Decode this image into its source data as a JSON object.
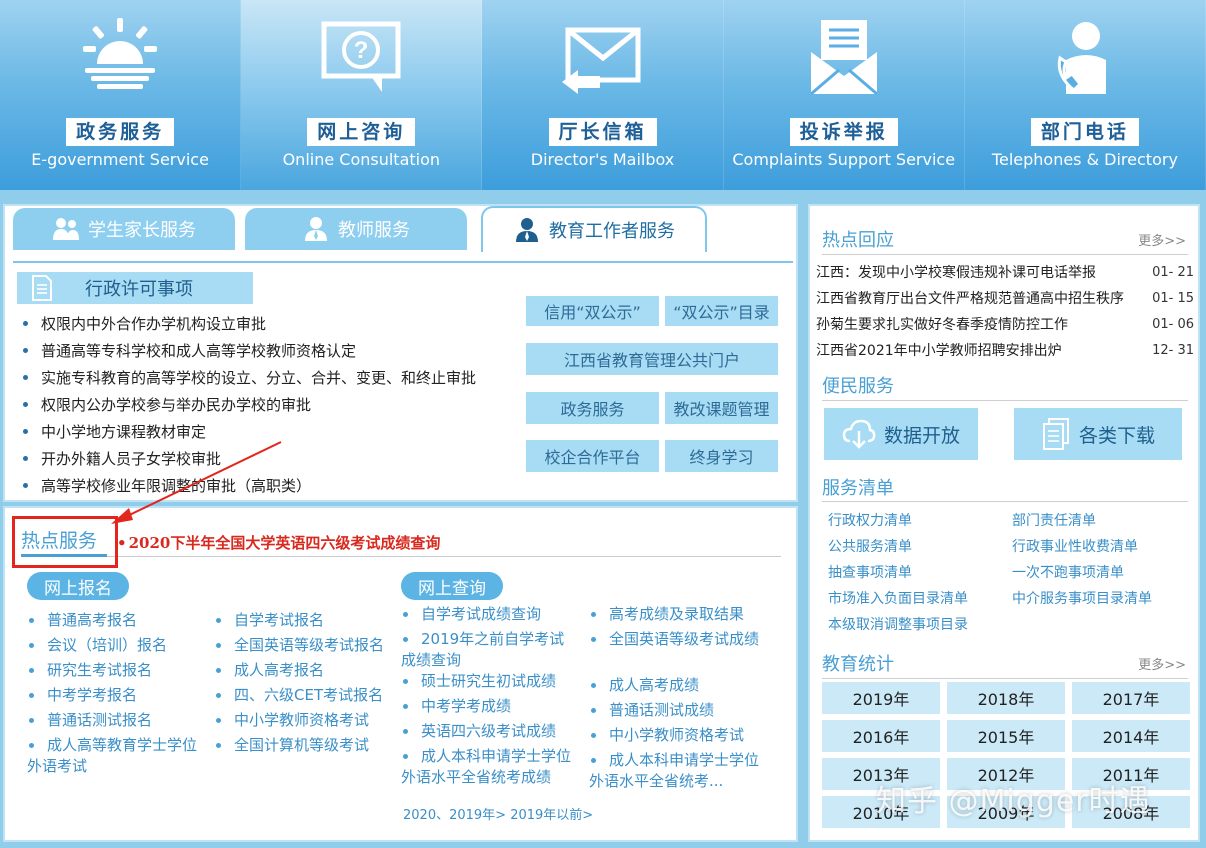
{
  "topnav": [
    {
      "cn": "政务服务",
      "en": "E-government Service",
      "icon": "sunrise-icon"
    },
    {
      "cn": "网上咨询",
      "en": "Online Consultation",
      "icon": "question-bubble-icon"
    },
    {
      "cn": "厅长信箱",
      "en": "Director's Mailbox",
      "icon": "mail-reply-icon"
    },
    {
      "cn": "投诉举报",
      "en": "Complaints Support Service",
      "icon": "complaint-mail-icon"
    },
    {
      "cn": "部门电话",
      "en": "Telephones & Directory",
      "icon": "phone-person-icon"
    }
  ],
  "tabs": [
    {
      "label": "学生家长服务",
      "icon": "parents-icon"
    },
    {
      "label": "教师服务",
      "icon": "teacher-icon"
    },
    {
      "label": "教育工作者服务",
      "icon": "educator-icon"
    }
  ],
  "admin": {
    "title": "行政许可事项",
    "items": [
      "权限内中外合作办学机构设立审批",
      "普通高等专科学校和成人高等学校教师资格认定",
      "实施专科教育的高等学校的设立、分立、合并、变更、和终止审批",
      "权限内公办学校参与举办民办学校的审批",
      "中小学地方课程教材审定",
      "开办外籍人员子女学校审批",
      "高等学校修业年限调整的审批（高职类）"
    ]
  },
  "quick": {
    "b1": "信用“双公示”",
    "b2": "“双公示”目录",
    "b3": "江西省教育管理公共门户",
    "b4": "政务服务",
    "b5": "教改课题管理",
    "b6": "校企合作平台",
    "b7": "终身学习"
  },
  "hot": {
    "title": "热点服务",
    "link": "2020下半年全国大学英语四六级考试成绩查询",
    "signup": {
      "title": "网上报名",
      "col1": [
        "普通高考报名",
        "会议（培训）报名",
        "研究生考试报名",
        "中考学考报名",
        "普通话测试报名"
      ],
      "col1_last_a": "成人高等教育学士学位",
      "col1_last_b": "外语考试",
      "col2": [
        "自学考试报名",
        "全国英语等级考试报名",
        "成人高考报名",
        "四、六级CET考试报名",
        "中小学教师资格考试",
        "全国计算机等级考试"
      ]
    },
    "query": {
      "title": "网上查询",
      "col1_a": "自学考试成绩查询",
      "col1_b1": "2019年之前自学考试",
      "col1_b2": "成绩查询",
      "col1_rest": [
        "硕士研究生初试成绩",
        "中考学考成绩",
        "英语四六级考试成绩"
      ],
      "col1_last_a": "成人本科申请学士学位",
      "col1_last_b": "外语水平全省统考成绩",
      "col2": [
        "高考成绩及录取结果",
        "全国英语等级考试成绩",
        "成人高考成绩",
        "普通话测试成绩",
        "中小学教师资格考试"
      ],
      "col2_last_a": "成人本科申请学士学位",
      "col2_last_b": "外语水平全省统考...",
      "years": "2020、2019年> 2019年以前>"
    }
  },
  "right": {
    "news_title": "热点回应",
    "more": "更多>>",
    "news": [
      {
        "title": "江西：发现中小学校寒假违规补课可电话举报",
        "date": "01- 21"
      },
      {
        "title": "江西省教育厅出台文件严格规范普通高中招生秩序",
        "date": "01- 15"
      },
      {
        "title": "孙菊生要求扎实做好冬春季疫情防控工作",
        "date": "01- 06"
      },
      {
        "title": "江西省2021年中小学教师招聘安排出炉",
        "date": "12- 31"
      }
    ],
    "convenience_title": "便民服务",
    "btn_data": "数据开放",
    "btn_download": "各类下载",
    "svc_title": "服务清单",
    "svc_left": [
      "行政权力清单",
      "公共服务清单",
      "抽查事项清单",
      "市场准入负面目录清单",
      "本级取消调整事项目录"
    ],
    "svc_right": [
      "部门责任清单",
      "行政事业性收费清单",
      "一次不跑事项清单",
      "中介服务事项目录清单"
    ],
    "stats_title": "教育统计",
    "stats_more": "更多>>",
    "years": [
      "2019年",
      "2018年",
      "2017年",
      "2016年",
      "2015年",
      "2014年",
      "2013年",
      "2012年",
      "2011年",
      "2010年",
      "2009年",
      "2008年"
    ]
  },
  "watermark": "知乎 @Migger时遇"
}
